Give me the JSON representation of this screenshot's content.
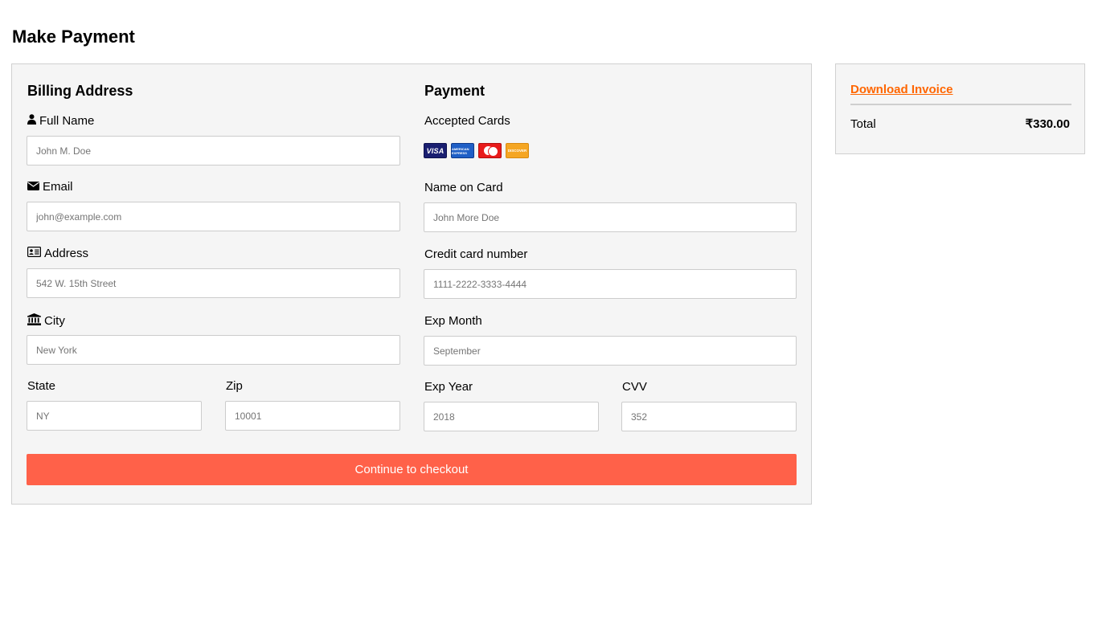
{
  "page": {
    "title": "Make Payment"
  },
  "billing": {
    "title": "Billing Address",
    "full_name": {
      "label": "Full Name",
      "placeholder": "John M. Doe",
      "icon": "user-icon"
    },
    "email": {
      "label": "Email",
      "placeholder": "john@example.com",
      "icon": "envelope-icon"
    },
    "address": {
      "label": "Address",
      "placeholder": "542 W. 15th Street",
      "icon": "address-card-icon"
    },
    "city": {
      "label": "City",
      "placeholder": "New York",
      "icon": "institution-icon"
    },
    "state": {
      "label": "State",
      "placeholder": "NY"
    },
    "zip": {
      "label": "Zip",
      "placeholder": "10001"
    }
  },
  "payment": {
    "title": "Payment",
    "accepted_cards_label": "Accepted Cards",
    "cards": [
      {
        "icon": "visa-card-icon",
        "text": "VISA"
      },
      {
        "icon": "amex-card-icon",
        "text": "AMERICAN EXPRESS"
      },
      {
        "icon": "mastercard-icon",
        "text": ""
      },
      {
        "icon": "discover-card-icon",
        "text": "DISCOVER"
      }
    ],
    "name_on_card": {
      "label": "Name on Card",
      "placeholder": "John More Doe"
    },
    "card_number": {
      "label": "Credit card number",
      "placeholder": "1111-2222-3333-4444"
    },
    "exp_month": {
      "label": "Exp Month",
      "placeholder": "September"
    },
    "exp_year": {
      "label": "Exp Year",
      "placeholder": "2018"
    },
    "cvv": {
      "label": "CVV",
      "placeholder": "352"
    }
  },
  "checkout": {
    "button_label": "Continue to checkout",
    "color": "#ff6149"
  },
  "summary": {
    "invoice_link": "Download Invoice",
    "invoice_link_color": "#ff6600",
    "total_label": "Total",
    "total_value": "₹330.00"
  }
}
